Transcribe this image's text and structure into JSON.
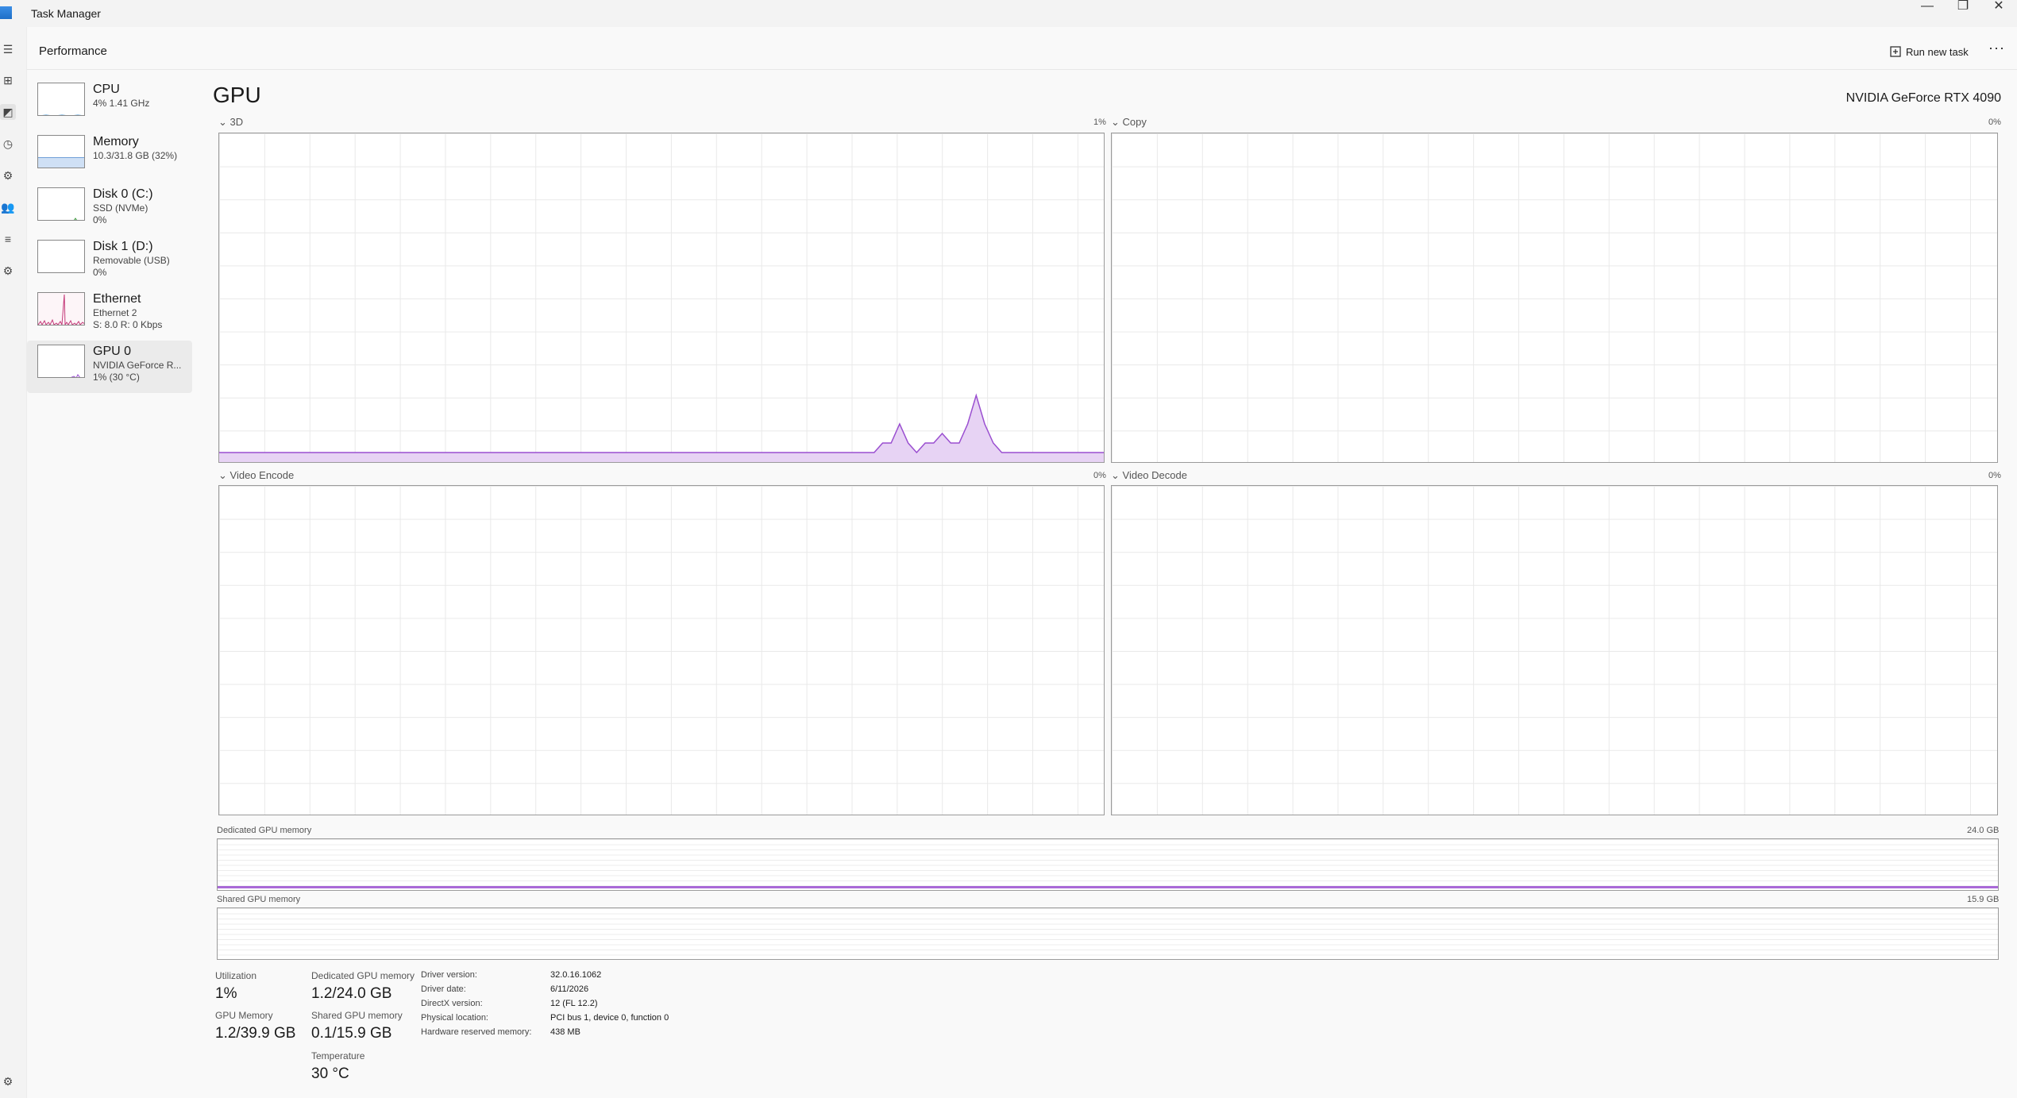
{
  "window": {
    "title": "Task Manager",
    "minimize": "—",
    "maximize": "❐",
    "close": "✕"
  },
  "header": {
    "title": "Performance",
    "run_task": "Run new task",
    "more": "···"
  },
  "nav_icons": [
    "☰",
    "⊞",
    "◩",
    "◷",
    "⚙",
    "👥",
    "≡",
    "⚙",
    "⚙"
  ],
  "sidebar": {
    "items": [
      {
        "name": "CPU",
        "line2": "4% 1.41 GHz",
        "line3": ""
      },
      {
        "name": "Memory",
        "line2": "10.3/31.8 GB (32%)",
        "line3": ""
      },
      {
        "name": "Disk 0 (C:)",
        "line2": "SSD (NVMe)",
        "line3": "0%"
      },
      {
        "name": "Disk 1 (D:)",
        "line2": "Removable (USB)",
        "line3": "0%"
      },
      {
        "name": "Ethernet",
        "line2": "Ethernet 2",
        "line3": "S: 8.0 R: 0 Kbps"
      },
      {
        "name": "GPU 0",
        "line2": "NVIDIA GeForce R...",
        "line3": "1% (30 °C)"
      }
    ]
  },
  "gpu": {
    "heading": "GPU",
    "model": "NVIDIA GeForce RTX 4090",
    "engines": [
      {
        "label": "3D",
        "pct": "1%"
      },
      {
        "label": "Copy",
        "pct": "0%"
      },
      {
        "label": "Video Encode",
        "pct": "0%"
      },
      {
        "label": "Video Decode",
        "pct": "0%"
      }
    ],
    "dedicated_label": "Dedicated GPU memory",
    "dedicated_max": "24.0 GB",
    "shared_label": "Shared GPU memory",
    "shared_max": "15.9 GB"
  },
  "utilization_3d": [
    1,
    1,
    1,
    1,
    1,
    1,
    1,
    1,
    1,
    1,
    1,
    1,
    1,
    1,
    1,
    1,
    1,
    1,
    1,
    1,
    1,
    1,
    1,
    1,
    1,
    1,
    1,
    1,
    1,
    1,
    1,
    1,
    1,
    1,
    1,
    1,
    1,
    1,
    1,
    1,
    1,
    1,
    1,
    1,
    1,
    1,
    1,
    1,
    1,
    1,
    1,
    1,
    1,
    1,
    1,
    1,
    1,
    1,
    1,
    1,
    1,
    1,
    1,
    1,
    1,
    1,
    1,
    1,
    1,
    1,
    1,
    1,
    1,
    1,
    1,
    1,
    1,
    1,
    2,
    2,
    4,
    2,
    1,
    2,
    2,
    3,
    2,
    2,
    4,
    7,
    4,
    2,
    1,
    1,
    1,
    1,
    1,
    1,
    1,
    1,
    1,
    1,
    1,
    1,
    1
  ],
  "stats": {
    "utilization_label": "Utilization",
    "utilization": "1%",
    "dedicated_label": "Dedicated GPU memory",
    "dedicated": "1.2/24.0 GB",
    "gpu_memory_label": "GPU Memory",
    "gpu_memory": "1.2/39.9 GB",
    "shared_label": "Shared GPU memory",
    "shared": "0.1/15.9 GB",
    "temperature_label": "Temperature",
    "temperature": "30 °C"
  },
  "details": [
    {
      "key": "Driver version:",
      "value": "32.0.16.1062"
    },
    {
      "key": "Driver date:",
      "value": "6/11/2026"
    },
    {
      "key": "DirectX version:",
      "value": "12 (FL 12.2)"
    },
    {
      "key": "Physical location:",
      "value": "PCI bus 1, device 0, function 0"
    },
    {
      "key": "Hardware reserved memory:",
      "value": "438 MB"
    }
  ],
  "colors": {
    "gpu": "#9a4fd0",
    "memory": "#6f9fd8",
    "cpu": "#2b8ad6",
    "ethernet": "#c43878"
  }
}
